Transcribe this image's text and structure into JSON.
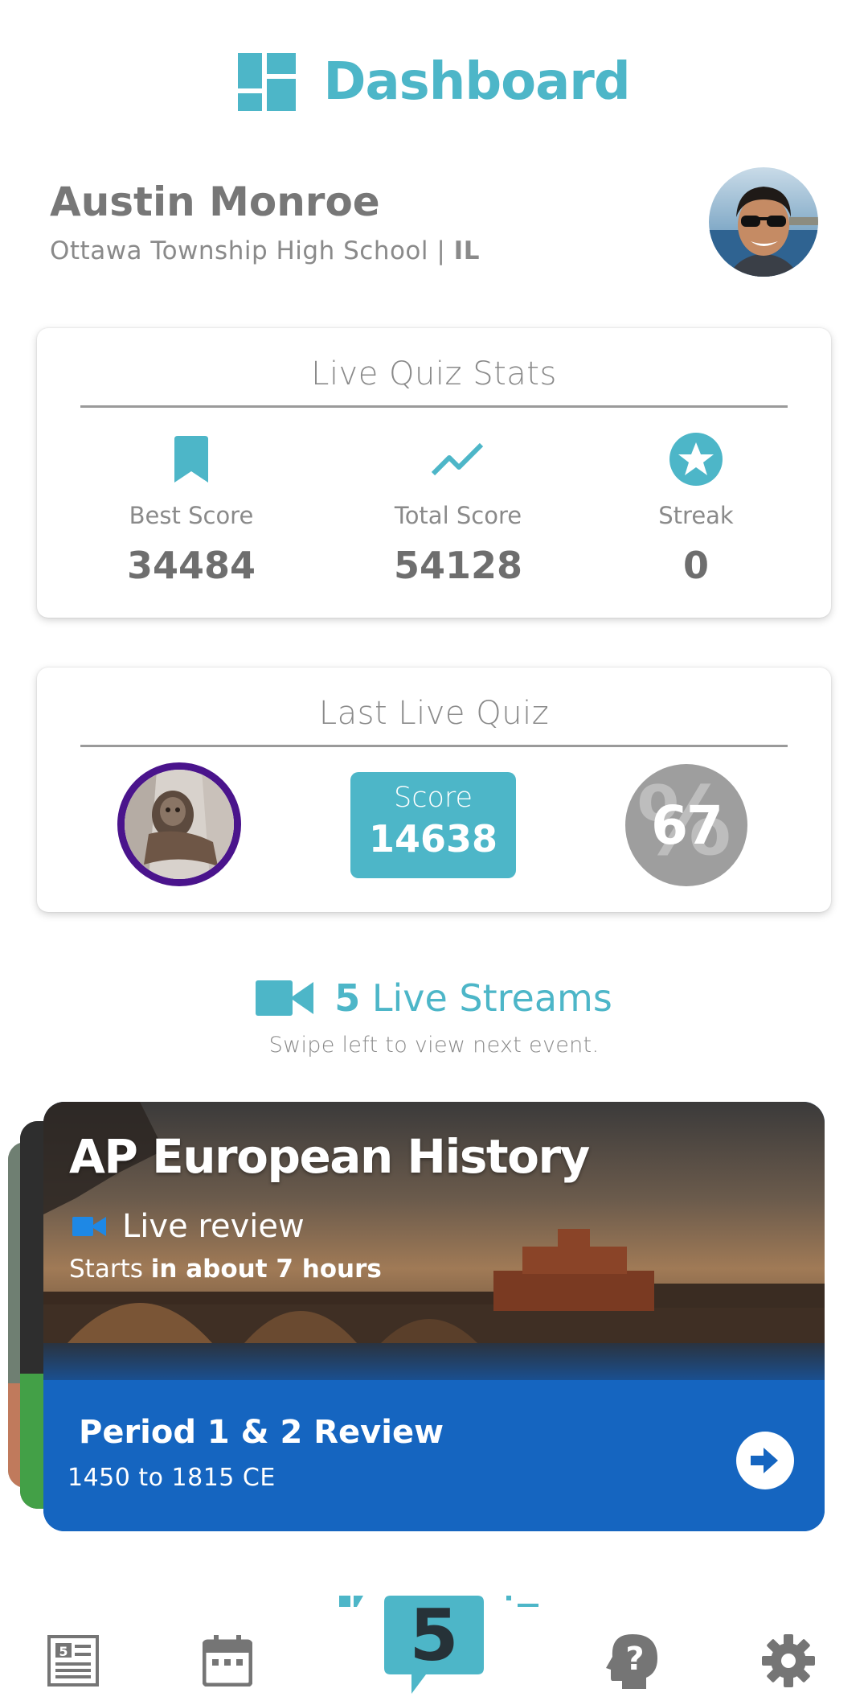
{
  "header": {
    "title": "Dashboard",
    "logo_icon": "dashboard-grid-icon",
    "accent": "#4db6c8"
  },
  "profile": {
    "name": "Austin Monroe",
    "school": "Ottawa Township High School |",
    "state": "IL"
  },
  "live_quiz_stats": {
    "title": "Live Quiz Stats",
    "stats": [
      {
        "icon": "bookmark-icon",
        "label": "Best Score",
        "value": "34484"
      },
      {
        "icon": "trending-up-icon",
        "label": "Total Score",
        "value": "54128"
      },
      {
        "icon": "star-badge-icon",
        "label": "Streak",
        "value": "0"
      }
    ]
  },
  "last_live_quiz": {
    "title": "Last Live Quiz",
    "score_label": "Score",
    "score_value": "14638",
    "percent": "67"
  },
  "live_streams": {
    "count": "5",
    "label": "Live Streams",
    "subtitle": "Swipe left to view next event."
  },
  "event": {
    "title": "AP European History",
    "type": "Live review",
    "starts_prefix": "Starts",
    "starts_when": "in about 7 hours",
    "session_title": "Period 1 & 2 Review",
    "session_range": "1450 to 1815 CE",
    "color": "#1565c0"
  },
  "bottom_nav": {
    "items": [
      "news-icon",
      "calendar-icon",
      "home-5-icon",
      "help-icon",
      "settings-icon"
    ],
    "center_label": "5"
  }
}
